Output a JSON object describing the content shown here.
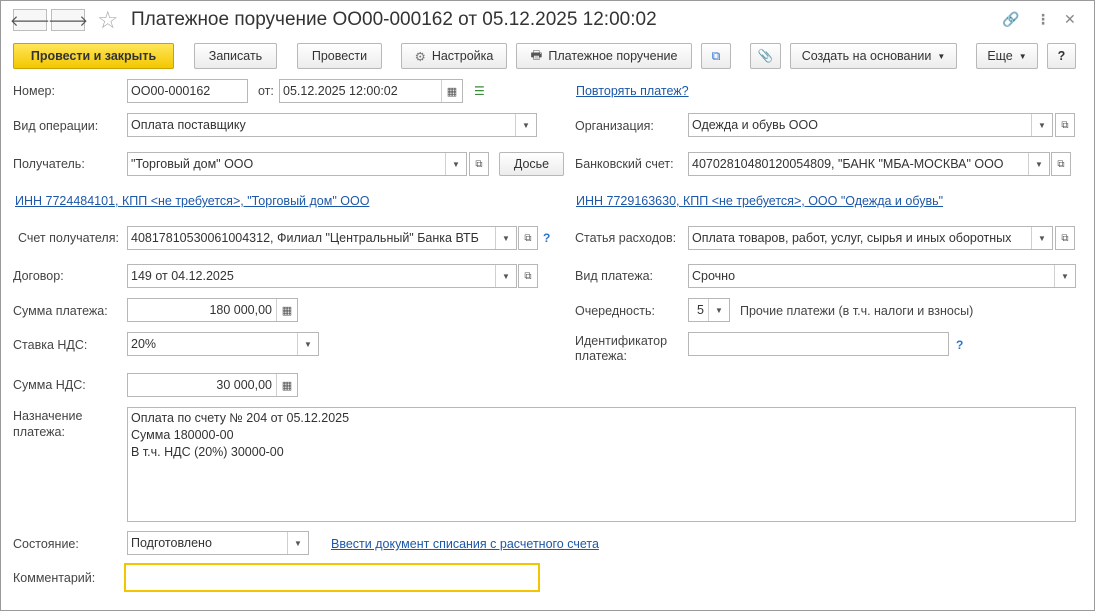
{
  "window": {
    "title": "Платежное поручение ОО00-000162 от 05.12.2025 12:00:02",
    "nav_back": "🡐",
    "nav_forward": "🡒",
    "star": "☆",
    "link_icon": "🔗",
    "more_icon": "⋮",
    "close_icon": "✕"
  },
  "toolbar": {
    "post_close": "Провести и закрыть",
    "save": "Записать",
    "post": "Провести",
    "settings": "Настройка",
    "settings_icon": "⚙",
    "print_order": "Платежное поручение",
    "print_icon": "🖶",
    "structure_icon": "⧉",
    "attach_icon": "📎",
    "create_based": "Создать на основании",
    "more": "Еще",
    "help": "?"
  },
  "form": {
    "number_label": "Номер:",
    "number_value": "ОО00-000162",
    "date_label": "от:",
    "date_value": "05.12.2025 12:00:02",
    "repeat_link": "Повторять платеж?",
    "operation_label": "Вид операции:",
    "operation_value": "Оплата поставщику",
    "org_label": "Организация:",
    "org_value": "Одежда и обувь ООО",
    "recipient_label": "Получатель:",
    "recipient_value": "\"Торговый дом\" ООО",
    "dossier_button": "Досье",
    "bank_account_label": "Банковский счет:",
    "bank_account_value": "40702810480120054809, \"БАНК \"МБА-МОСКВА\" ООО",
    "recipient_inn_link": "ИНН 7724484101, КПП <не требуется>, \"Торговый дом\" ООО",
    "org_inn_link": "ИНН 7729163630, КПП <не требуется>, ООО \"Одежда и обувь\"",
    "recipient_account_label": "Счет получателя:",
    "recipient_account_value": "40817810530061004312, Филиал \"Центральный\" Банка ВТБ",
    "expense_item_label": "Статья расходов:",
    "expense_item_value": "Оплата товаров, работ, услуг, сырья и иных оборотных",
    "contract_label": "Договор:",
    "contract_value": "149 от 04.12.2025",
    "payment_type_label": "Вид платежа:",
    "payment_type_value": "Срочно",
    "amount_label": "Сумма платежа:",
    "amount_value": "180 000,00",
    "priority_label": "Очередность:",
    "priority_value": "5",
    "priority_desc": "Прочие платежи (в т.ч. налоги и взносы)",
    "vat_rate_label": "Ставка НДС:",
    "vat_rate_value": "20%",
    "payment_id_label_1": "Идентификатор",
    "payment_id_label_2": "платежа:",
    "payment_id_value": "",
    "vat_amount_label": "Сумма НДС:",
    "vat_amount_value": "30 000,00",
    "purpose_label_1": "Назначение",
    "purpose_label_2": "платежа:",
    "purpose_lines": [
      "Оплата по счету № 204 от 05.12.2025",
      "Сумма 180000-00",
      "В т.ч. НДС  (20%) 30000-00"
    ],
    "state_label": "Состояние:",
    "state_value": "Подготовлено",
    "write_off_link": "Ввести документ списания с расчетного счета",
    "comment_label": "Комментарий:",
    "comment_value": "",
    "question_mark": "?"
  },
  "colors": {
    "primary_button": "#f3c800",
    "link": "#1d58a8",
    "help_mark": "#2f76c9",
    "comment_focus": "#f3c400"
  }
}
